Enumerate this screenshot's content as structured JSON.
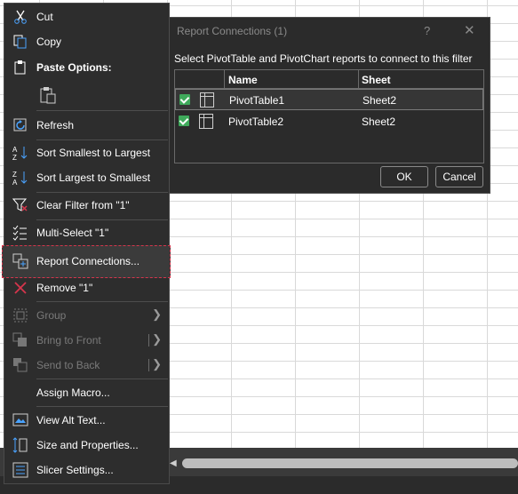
{
  "colors": {
    "menu_bg": "#2d2d2d",
    "dialog_bg": "#2b2b2b",
    "highlight_border": "#d6354c",
    "checkbox": "#3faa5b"
  },
  "menu": {
    "cut": "Cut",
    "copy": "Copy",
    "paste_options": "Paste Options:",
    "refresh": "Refresh",
    "sort_asc": "Sort Smallest to Largest",
    "sort_desc": "Sort Largest to Smallest",
    "clear_filter": "Clear Filter from \"1\"",
    "multi_select": "Multi-Select \"1\"",
    "report_connections": "Report Connections...",
    "remove": "Remove \"1\"",
    "group": "Group",
    "bring_to_front": "Bring to Front",
    "send_to_back": "Send to Back",
    "assign_macro": "Assign Macro...",
    "view_alt_text": "View Alt Text...",
    "size_and_properties": "Size and Properties...",
    "slicer_settings": "Slicer Settings...",
    "icons": [
      "scissors-icon",
      "copy-icon",
      "clipboard-icon",
      "refresh-icon",
      "sort-ascending-icon",
      "sort-descending-icon",
      "clear-filter-icon",
      "multi-select-icon",
      "report-connections-icon",
      "remove-x-icon",
      "group-icon",
      "bring-to-front-icon",
      "send-to-back-icon",
      "alt-text-icon",
      "size-properties-icon",
      "slicer-settings-icon"
    ]
  },
  "dialog": {
    "title": "Report Connections (1)",
    "help": "?",
    "close": "✕",
    "instruction": "Select PivotTable and PivotChart reports to connect to this filter",
    "columns": {
      "name": "Name",
      "sheet": "Sheet"
    },
    "rows": [
      {
        "name": "PivotTable1",
        "sheet": "Sheet2",
        "checked": true
      },
      {
        "name": "PivotTable2",
        "sheet": "Sheet2",
        "checked": true
      }
    ],
    "ok": "OK",
    "cancel": "Cancel"
  }
}
